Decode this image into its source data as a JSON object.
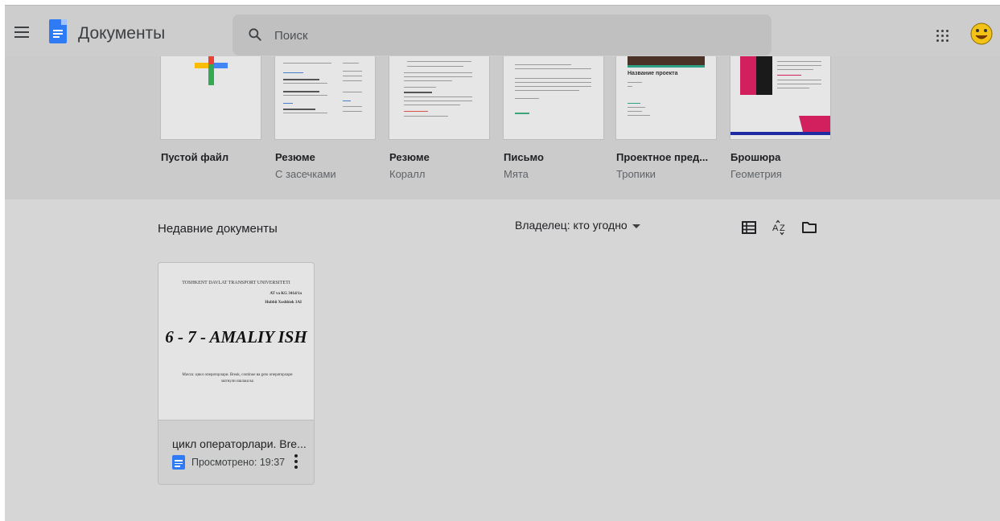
{
  "header": {
    "app_title": "Документы",
    "search_placeholder": "Поиск",
    "menu_icon": "hamburger-menu-icon",
    "apps_icon": "apps-grid-icon",
    "avatar_icon": "smiley-avatar"
  },
  "templates": [
    {
      "name": "Пустой файл",
      "subtitle": ""
    },
    {
      "name": "Резюме",
      "subtitle": "С засечками"
    },
    {
      "name": "Резюме",
      "subtitle": "Коралл"
    },
    {
      "name": "Письмо",
      "subtitle": "Мята"
    },
    {
      "name": "Проектное пред...",
      "subtitle": "Тропики",
      "thumb_heading": "Название проекта"
    },
    {
      "name": "Брошюра",
      "subtitle": "Геометрия"
    }
  ],
  "recent": {
    "title": "Недавние документы",
    "owner_filter": "Владелец: кто угодно",
    "view_icons": [
      "list-view-icon",
      "sort-az-icon",
      "folder-icon"
    ],
    "documents": [
      {
        "name": "цикл операторлари. Bre...",
        "viewed": "Просмотрено: 19:37",
        "preview": {
          "university": "TOSHKENT DAVLAT TRANSPORT UNIVERSITETI",
          "line1": "AT va KG  341d/1a",
          "line2": "Hubbii Xoshbiek  3AI",
          "title": "6 - 7 - AMALIY ISH",
          "text": "Mavzu: цикл операторлари. Break, continue ва goto операторлари матнули ишлаш ва"
        }
      }
    ]
  },
  "colors": {
    "docs_blue": "#2f7bf5",
    "background": "#d6d6d6"
  }
}
